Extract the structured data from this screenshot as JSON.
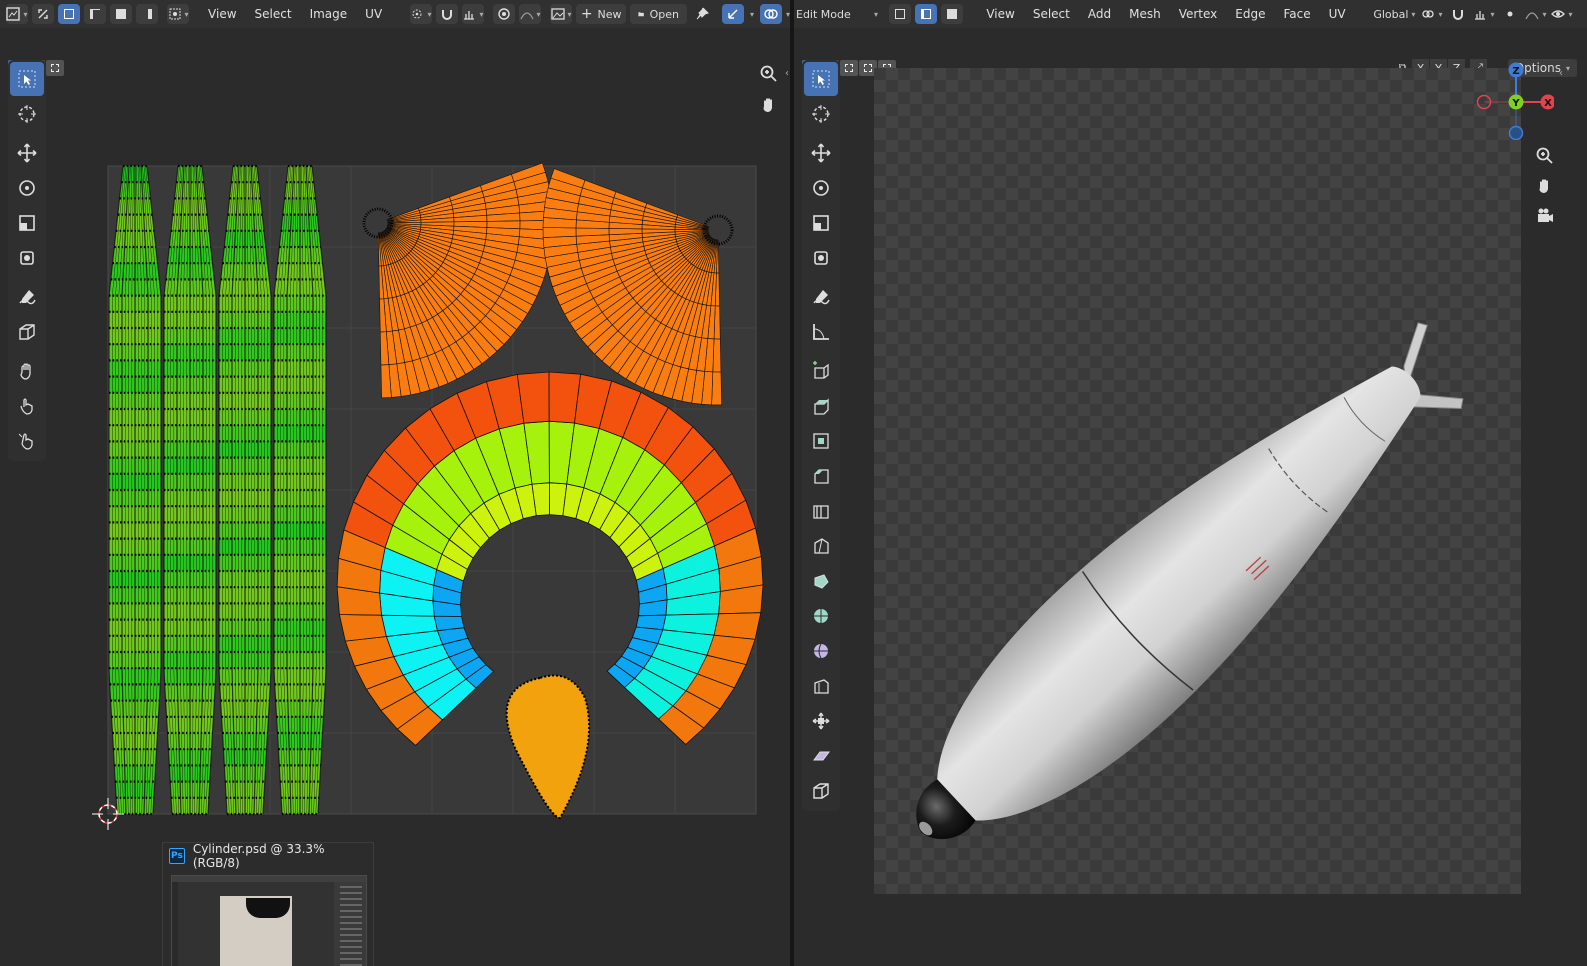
{
  "uv_editor": {
    "menus": [
      "View",
      "Select",
      "Image",
      "UV"
    ],
    "new_label": "New",
    "open_label": "Open"
  },
  "viewport": {
    "mode_label": "Edit Mode",
    "menus": [
      "View",
      "Select",
      "Add",
      "Mesh",
      "Vertex",
      "Edge",
      "Face",
      "UV"
    ],
    "orientation_label": "Global",
    "options_label": "Options",
    "axes": [
      "X",
      "Y",
      "Z"
    ],
    "gizmo": {
      "x": "X",
      "y": "Y",
      "z": "Z"
    }
  },
  "taskbar_preview": {
    "app_badge": "Ps",
    "title": "Cylinder.psd @ 33.3% (RGB/8)"
  },
  "colors": {
    "accent": "#4772b3",
    "gizmo_x": "#e0444e",
    "gizmo_y": "#7fcf28",
    "gizmo_z": "#3f7cd6"
  }
}
